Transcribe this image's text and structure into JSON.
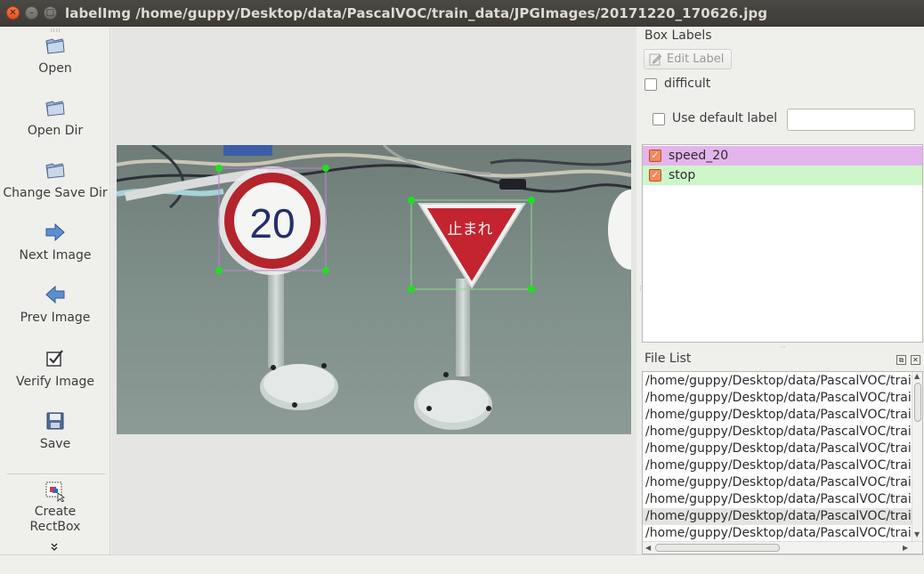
{
  "window": {
    "title": "labelImg /home/guppy/Desktop/data/PascalVOC/train_data/JPGImages/20171220_170626.jpg",
    "controls": [
      "close-icon",
      "minimize-icon",
      "maximize-icon"
    ]
  },
  "toolbar": {
    "items": [
      {
        "label": "Open",
        "icon": "folder-open-icon"
      },
      {
        "label": "Open Dir",
        "icon": "folder-open-icon"
      },
      {
        "label": "Change Save Dir",
        "icon": "folder-open-icon"
      },
      {
        "label": "Next Image",
        "icon": "arrow-right-icon"
      },
      {
        "label": "Prev Image",
        "icon": "arrow-left-icon"
      },
      {
        "label": "Verify Image",
        "icon": "checkbox-icon"
      },
      {
        "label": "Save",
        "icon": "floppy-disk-icon"
      },
      {
        "label": "Create\nRectBox",
        "icon": "rectbox-icon"
      }
    ],
    "more": "»"
  },
  "image": {
    "sign1_text": "20",
    "sign2_text": "止まれ",
    "box_colors": {
      "speed_20": "#c77fd6",
      "stop": "#8fd88a"
    },
    "handle_color": "#1fe01f"
  },
  "box_labels": {
    "title": "Box Labels",
    "edit_label": "Edit Label",
    "difficult": "difficult",
    "use_default_label": "Use default label",
    "default_label_value": "",
    "labels": [
      {
        "name": "speed_20",
        "checked": true,
        "color": "#e4b4ec"
      },
      {
        "name": "stop",
        "checked": true,
        "color": "#cdf7c9"
      }
    ]
  },
  "file_list": {
    "title": "File List",
    "files": [
      "/home/guppy/Desktop/data/PascalVOC/trai",
      "/home/guppy/Desktop/data/PascalVOC/trai",
      "/home/guppy/Desktop/data/PascalVOC/trai",
      "/home/guppy/Desktop/data/PascalVOC/trai",
      "/home/guppy/Desktop/data/PascalVOC/trai",
      "/home/guppy/Desktop/data/PascalVOC/trai",
      "/home/guppy/Desktop/data/PascalVOC/trai",
      "/home/guppy/Desktop/data/PascalVOC/trai",
      "/home/guppy/Desktop/data/PascalVOC/trai",
      "/home/guppy/Desktop/data/PascalVOC/trai"
    ],
    "selected_index": 8
  }
}
